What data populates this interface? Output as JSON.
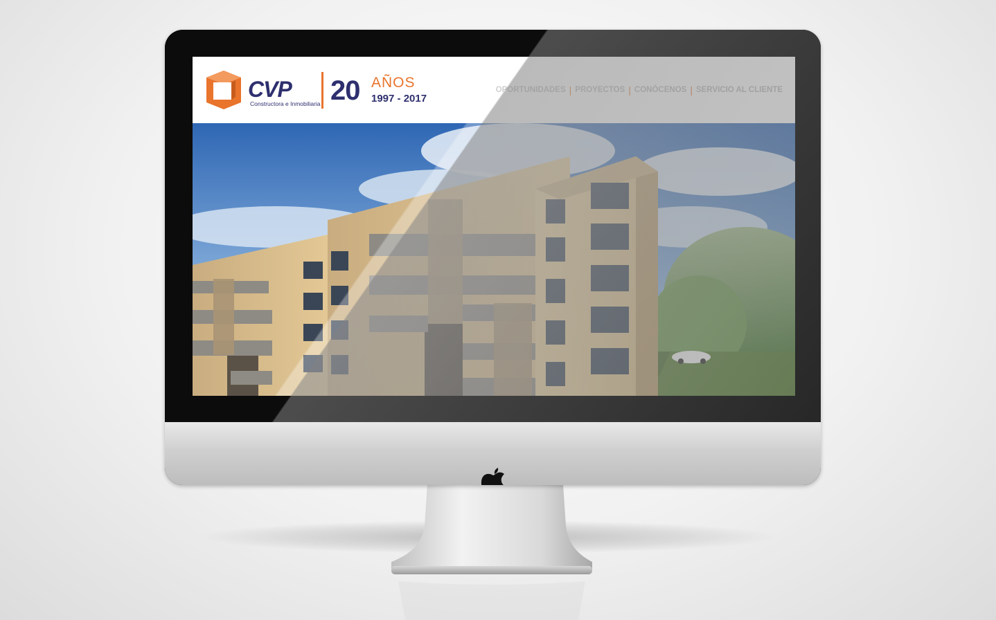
{
  "brand": {
    "logo_text": "CVP",
    "tagline": "Constructora e Inmobiliaria",
    "anniversary_number": "20",
    "anniversary_word": "AÑOS",
    "anniversary_years": "1997 - 2017",
    "accent_color": "#e9742c",
    "primary_color": "#2e2f6e"
  },
  "nav": {
    "items": [
      {
        "label": "OPORTUNIDADES"
      },
      {
        "label": "PROYECTOS"
      },
      {
        "label": "CONÓCENOS"
      },
      {
        "label": "SERVICIO AL CLIENTE"
      }
    ]
  },
  "hero": {
    "icon": "apartment-building-render"
  },
  "device": {
    "icon": "apple-logo-icon"
  }
}
